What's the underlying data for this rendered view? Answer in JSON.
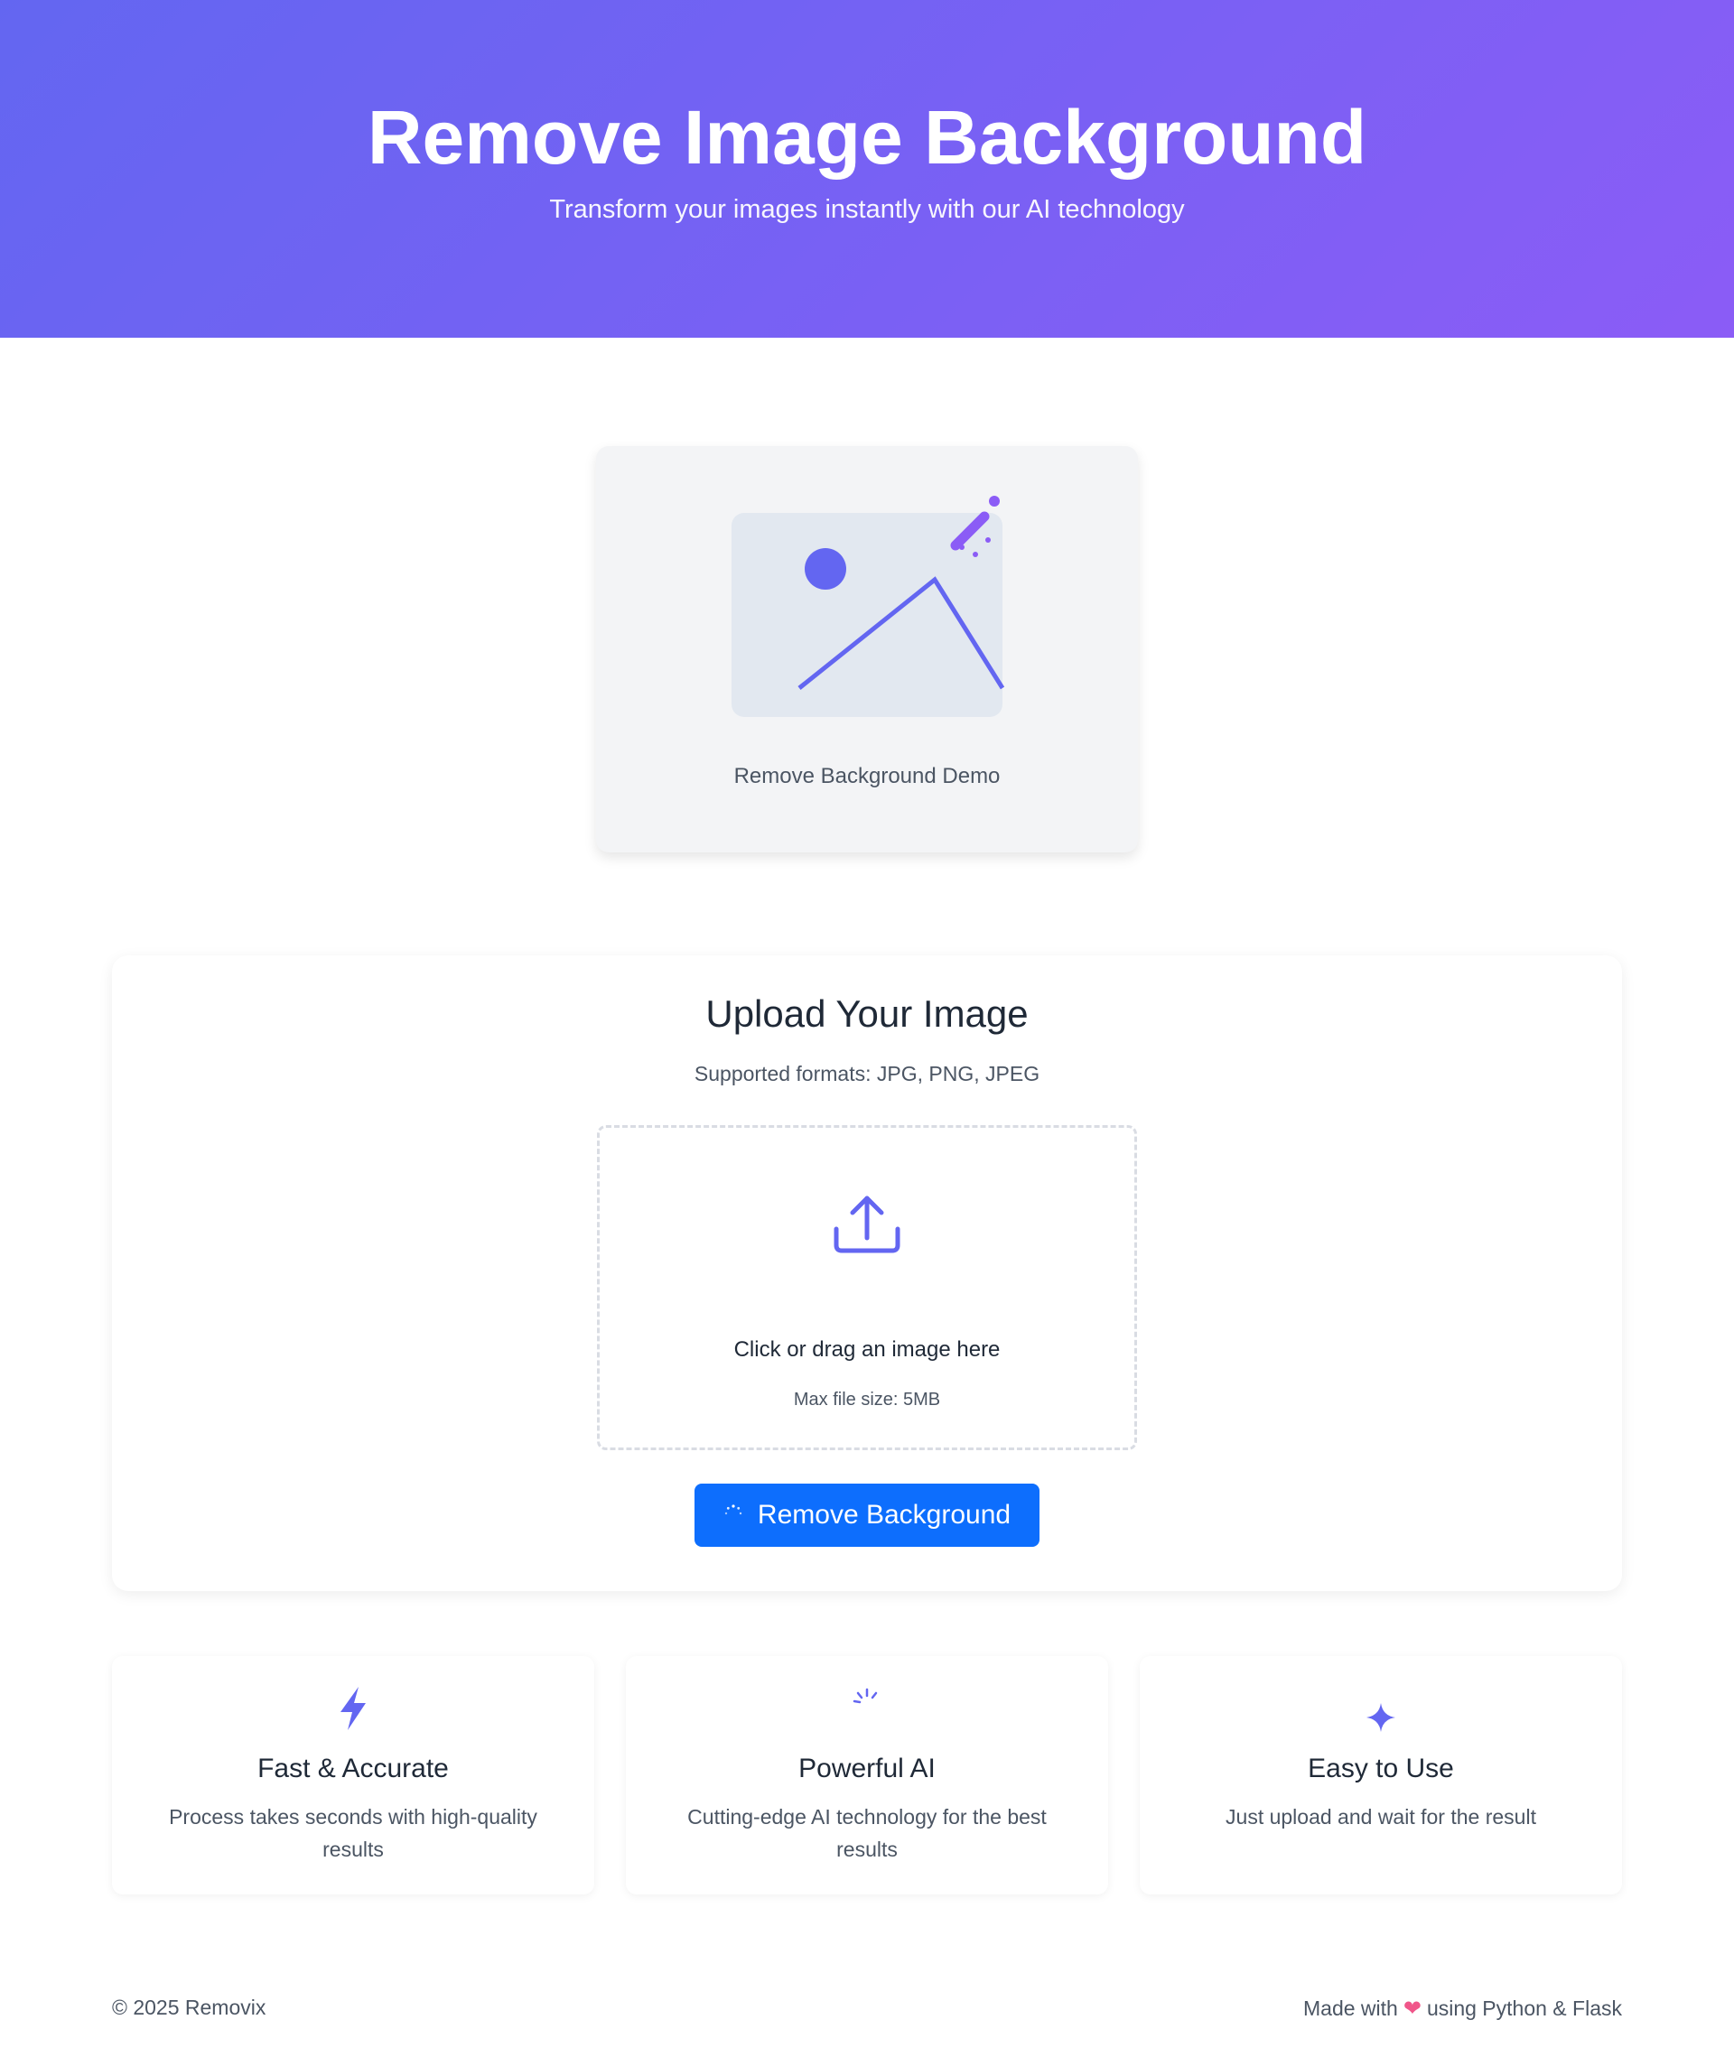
{
  "hero": {
    "title": "Remove Image Background",
    "subtitle": "Transform your images instantly with our AI technology"
  },
  "demo": {
    "label": "Remove Background Demo",
    "icon": "image-wand-icon"
  },
  "upload": {
    "title": "Upload Your Image",
    "formats": "Supported formats: JPG, PNG, JPEG",
    "drop_text": "Click or drag an image here",
    "max_size": "Max file size: 5MB",
    "button_label": "Remove Background",
    "icon": "upload-icon"
  },
  "features": [
    {
      "title": "Fast & Accurate",
      "description": "Process takes seconds with high-quality results",
      "icon": "lightning-icon"
    },
    {
      "title": "Powerful AI",
      "description": "Cutting-edge AI technology for the best results",
      "icon": "spinner-icon"
    },
    {
      "title": "Easy to Use",
      "description": "Just upload and wait for the result",
      "icon": "sparkle-icon"
    }
  ],
  "footer": {
    "copyright": "© 2025 Removix",
    "made_with_prefix": "Made with",
    "made_with_suffix": "using Python & Flask"
  },
  "colors": {
    "accent": "#6366f1",
    "accent_purple": "#8b5cf6",
    "button": "#0d6efd",
    "heart": "#f0568a"
  }
}
